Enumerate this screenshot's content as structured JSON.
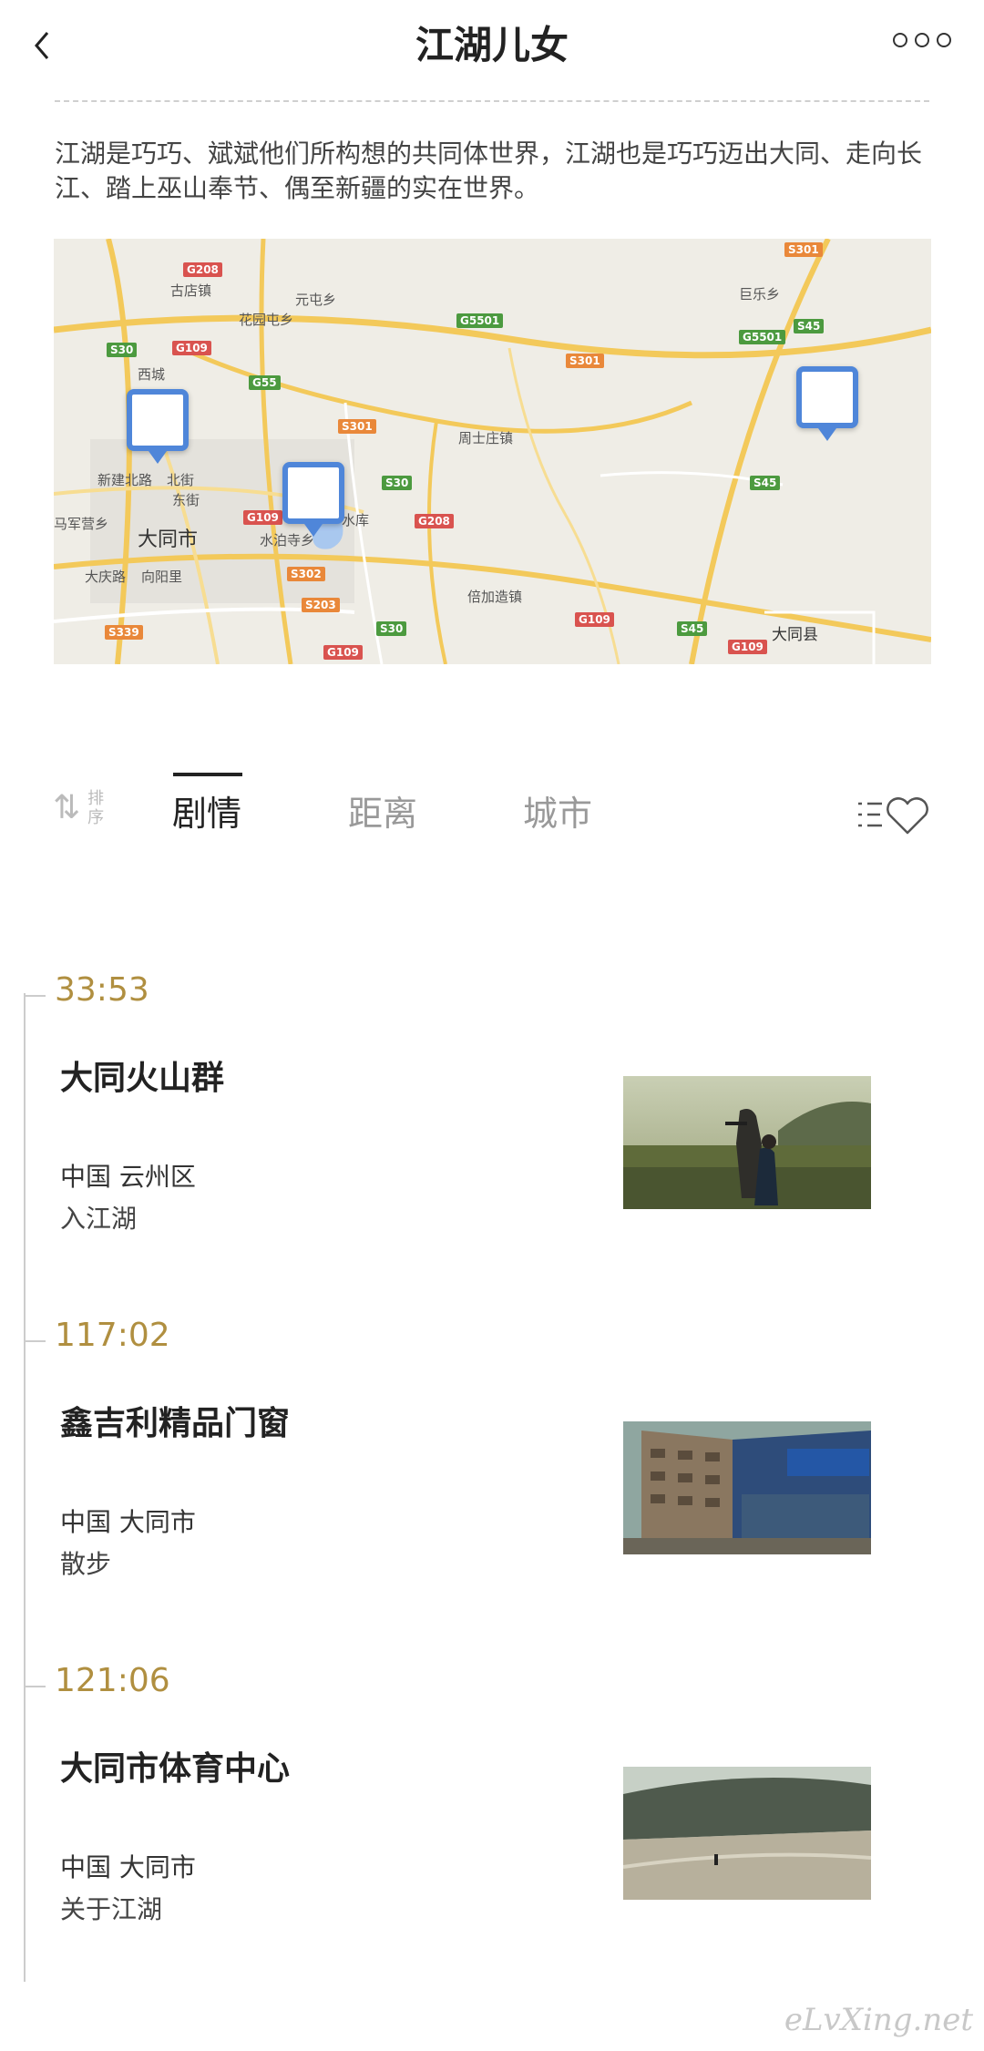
{
  "header": {
    "title": "江湖儿女"
  },
  "description": "江湖是巧巧、斌斌他们所构想的共同体世界，江湖也是巧巧迈出大同、走向长江、踏上巫山奉节、偶至新疆的实在世界。",
  "map": {
    "city_labels": [
      "大同市",
      "大同县"
    ],
    "place_labels": [
      "古店镇",
      "元屯乡",
      "花园屯乡",
      "西城",
      "新建北路",
      "北街",
      "东街",
      "水库",
      "水泊寺乡",
      "周士庄镇",
      "大庆路",
      "向阳里",
      "倍加造镇",
      "巨乐乡",
      "马军营乡"
    ],
    "road_shields": [
      {
        "label": "G208",
        "color": "red"
      },
      {
        "label": "S30",
        "color": "green"
      },
      {
        "label": "G109",
        "color": "red"
      },
      {
        "label": "G55",
        "color": "green"
      },
      {
        "label": "G5501",
        "color": "green"
      },
      {
        "label": "S301",
        "color": "orange"
      },
      {
        "label": "S301",
        "color": "orange"
      },
      {
        "label": "S30",
        "color": "green"
      },
      {
        "label": "G208",
        "color": "red"
      },
      {
        "label": "G109",
        "color": "red"
      },
      {
        "label": "S302",
        "color": "orange"
      },
      {
        "label": "S203",
        "color": "orange"
      },
      {
        "label": "S339",
        "color": "orange"
      },
      {
        "label": "G109",
        "color": "red"
      },
      {
        "label": "S30",
        "color": "green"
      },
      {
        "label": "G109",
        "color": "red"
      },
      {
        "label": "S45",
        "color": "green"
      },
      {
        "label": "G109",
        "color": "red"
      },
      {
        "label": "S301",
        "color": "orange"
      },
      {
        "label": "G5501",
        "color": "green"
      },
      {
        "label": "S45",
        "color": "green"
      },
      {
        "label": "S45",
        "color": "green"
      }
    ]
  },
  "tabs": {
    "sort_label": "排序",
    "items": [
      {
        "label": "剧情",
        "active": true
      },
      {
        "label": "距离",
        "active": false
      },
      {
        "label": "城市",
        "active": false
      }
    ]
  },
  "entries": [
    {
      "time": "33:53",
      "name": "大同火山群",
      "location": "中国 云州区",
      "tag": "入江湖"
    },
    {
      "time": "117:02",
      "name": "鑫吉利精品门窗",
      "location": "中国 大同市",
      "tag": "散步"
    },
    {
      "time": "121:06",
      "name": "大同市体育中心",
      "location": "中国 大同市",
      "tag": "关于江湖"
    }
  ],
  "watermark": "eLvXing.net",
  "colors": {
    "accent_time": "#b08f40",
    "pin_blue": "#4f86d9",
    "map_bg": "#efede6",
    "road_yellow": "#f3c95a"
  }
}
